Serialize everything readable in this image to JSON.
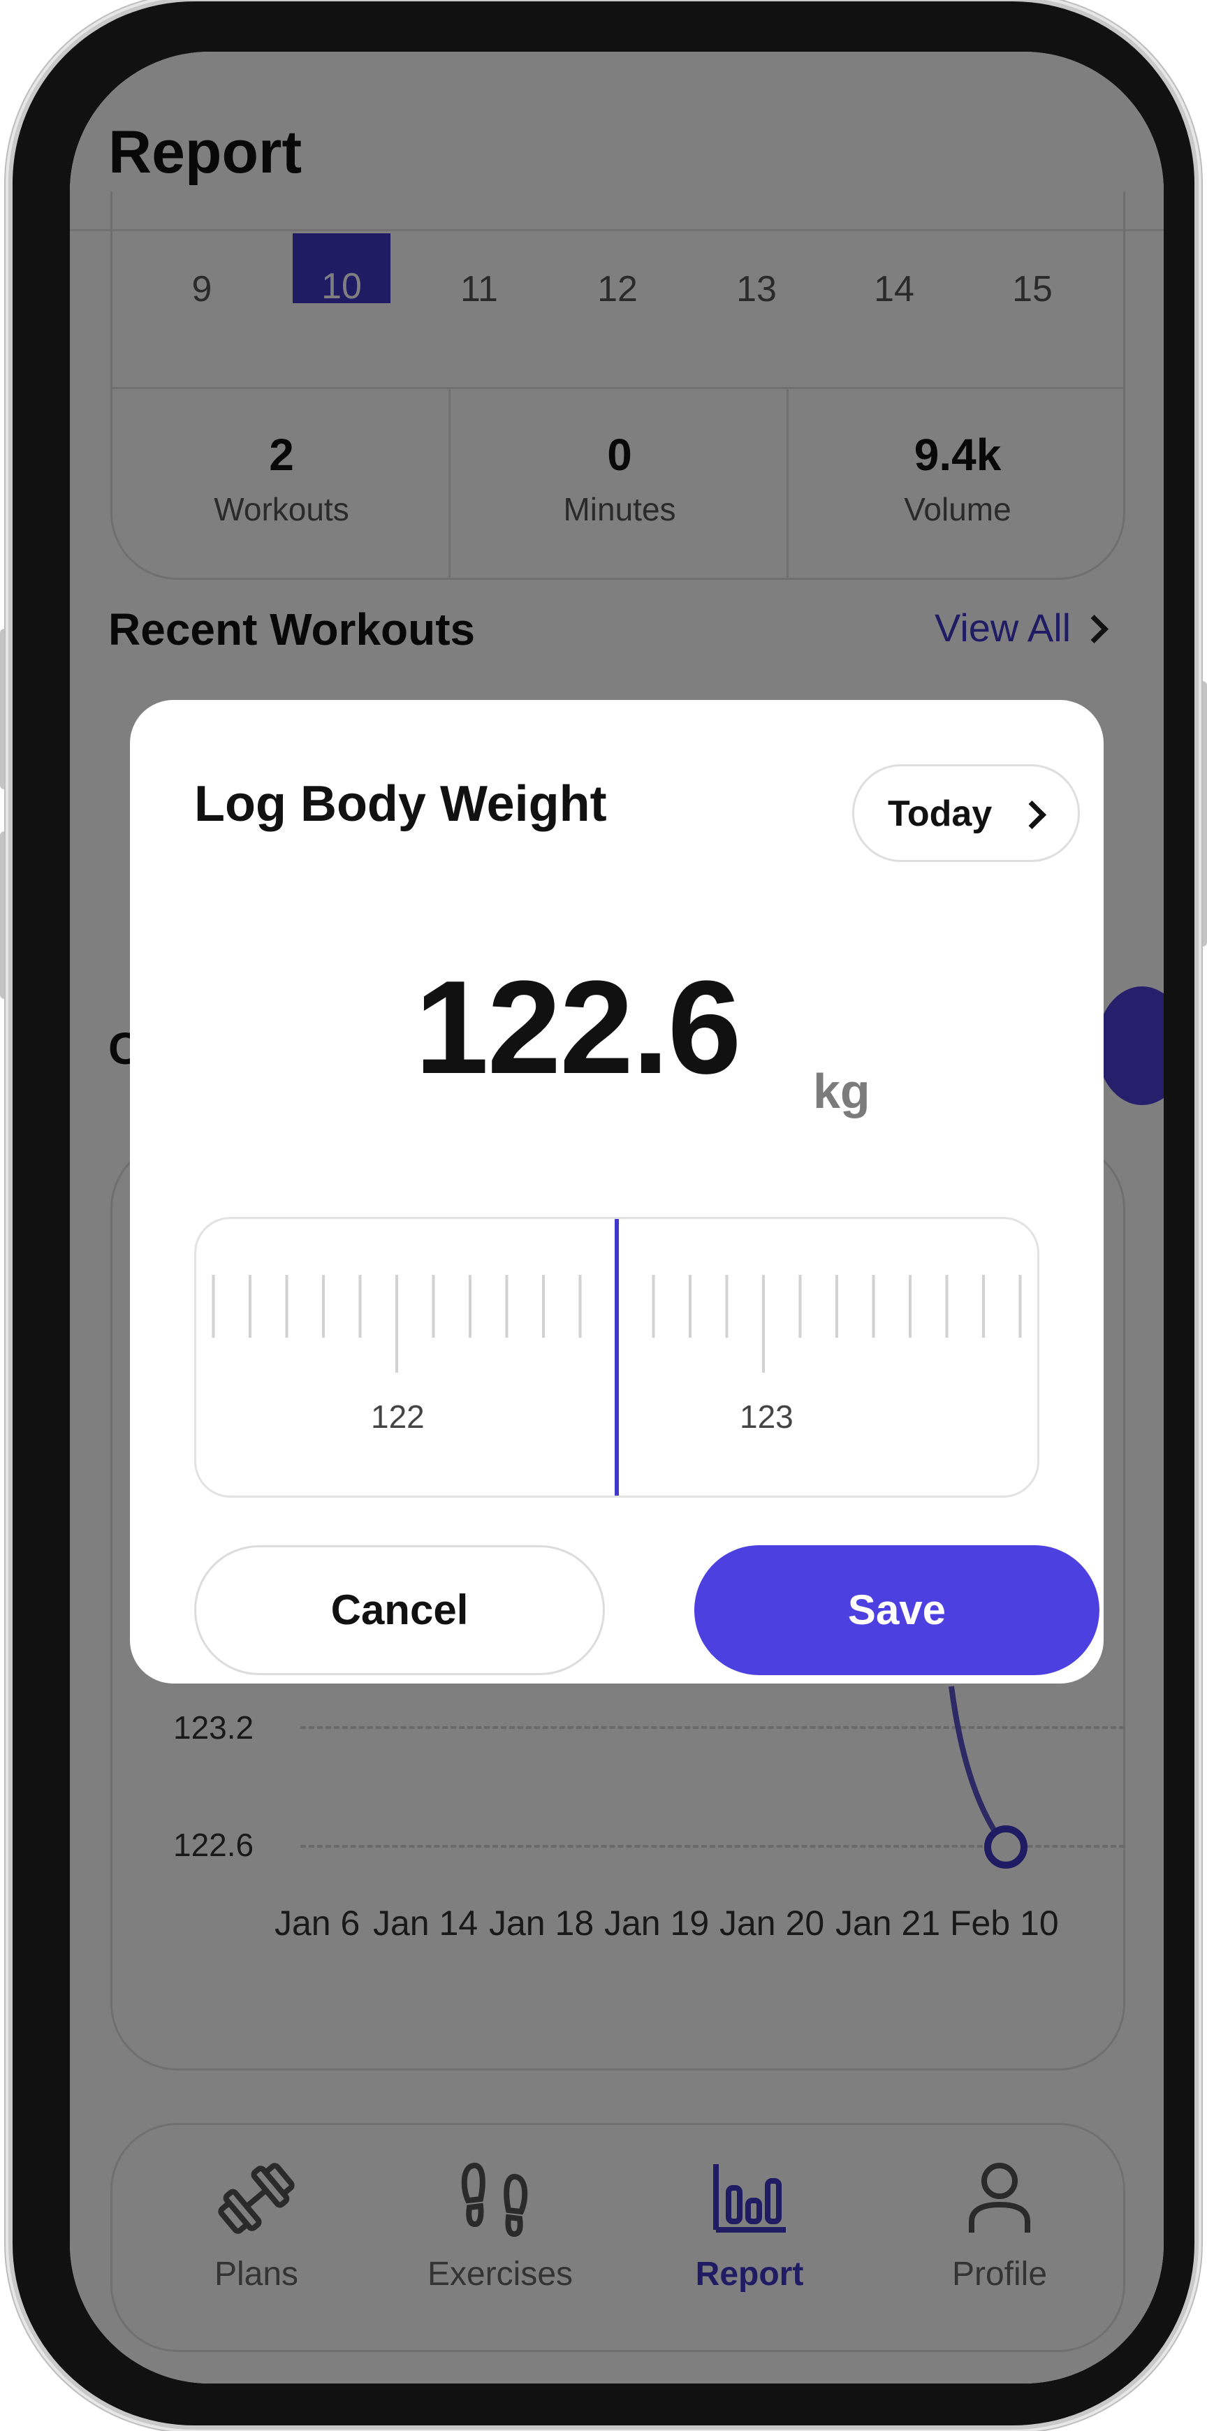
{
  "header": {
    "title": "Report"
  },
  "week": {
    "days": [
      "9",
      "10",
      "11",
      "12",
      "13",
      "14",
      "15"
    ],
    "selected_day": "10"
  },
  "stats": [
    {
      "value": "2",
      "label": "Workouts"
    },
    {
      "value": "0",
      "label": "Minutes"
    },
    {
      "value": "9.4k",
      "label": "Volume"
    }
  ],
  "recent": {
    "title": "Recent Workouts",
    "view_all": "View All"
  },
  "chart_data": {
    "type": "line",
    "categories": [
      "Jan 6",
      "Jan 14",
      "Jan 18",
      "Jan 19",
      "Jan 20",
      "Jan 21",
      "Feb 10"
    ],
    "y_tick_labels": [
      "123.2",
      "122.6"
    ],
    "visible_points": [
      {
        "x": "Feb 10",
        "y": 122.6
      }
    ],
    "grid": true
  },
  "nav": {
    "items": [
      {
        "label": "Plans",
        "icon": "dumbbell-icon"
      },
      {
        "label": "Exercises",
        "icon": "footprints-icon"
      },
      {
        "label": "Report",
        "icon": "bar-chart-icon",
        "active": true
      },
      {
        "label": "Profile",
        "icon": "person-icon"
      }
    ]
  },
  "modal": {
    "title": "Log Body Weight",
    "date_button": "Today",
    "value": "122.6",
    "unit": "kg",
    "ruler": {
      "labels": [
        "122",
        "123"
      ],
      "selected": 122.6,
      "step": 0.1
    },
    "cancel": "Cancel",
    "save": "Save"
  },
  "colors": {
    "accent": "#4c40e0",
    "accent_dark": "#3f38c9",
    "overlay": "rgba(0,0,0,0.5)"
  }
}
